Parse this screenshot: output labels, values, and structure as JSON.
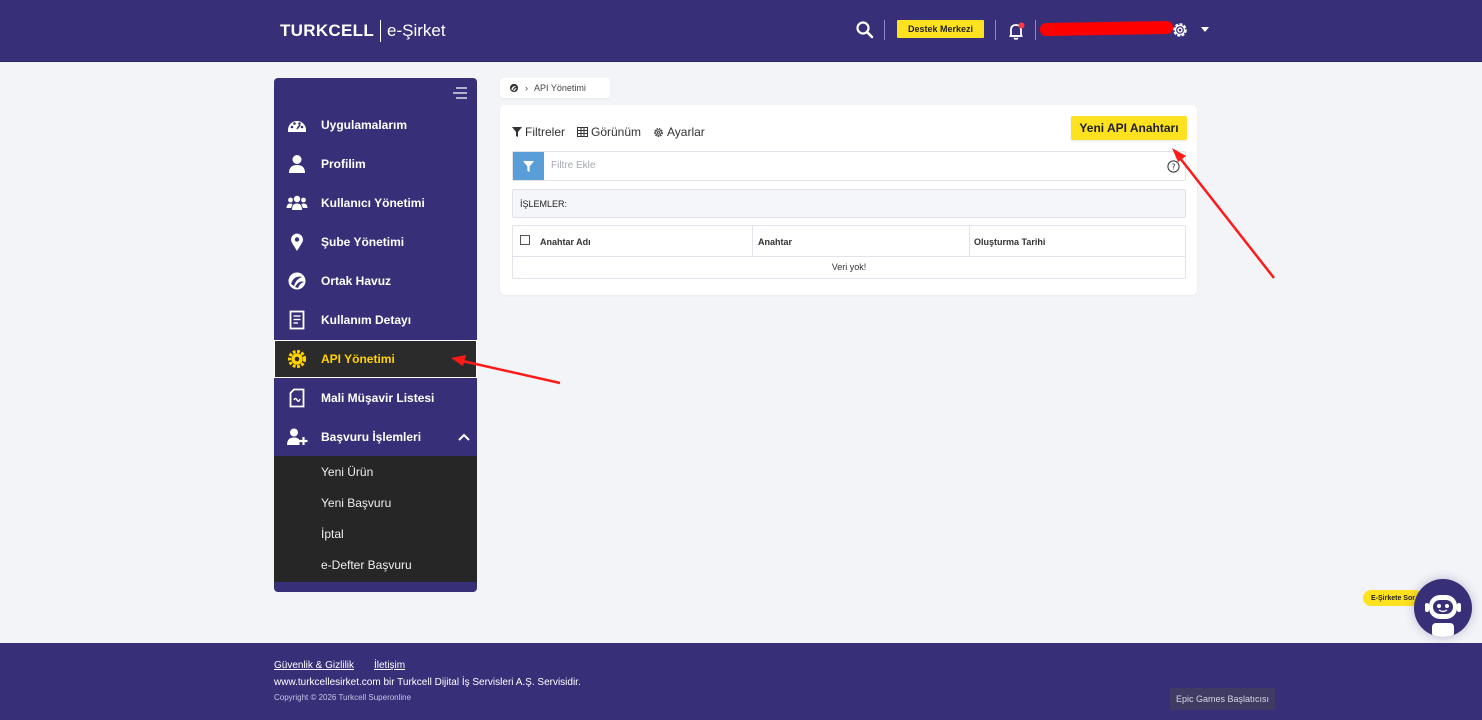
{
  "header": {
    "logo_brand": "TURKCELL",
    "logo_product": "e-Şirket",
    "support_label": "Destek Merkezi",
    "icons": [
      "search-icon",
      "bell-icon",
      "gear-icon",
      "caret-down-icon"
    ],
    "colors": {
      "primary": "#372f78",
      "accent": "#ffe21f"
    }
  },
  "breadcrumb": {
    "items": [
      "API Yönetimi"
    ]
  },
  "sidebar": {
    "items": [
      {
        "label": "Uygulamalarım",
        "icon": "dashboard-icon"
      },
      {
        "label": "Profilim",
        "icon": "user-icon"
      },
      {
        "label": "Kullanıcı Yönetimi",
        "icon": "users-icon"
      },
      {
        "label": "Şube Yönetimi",
        "icon": "location-pin-icon"
      },
      {
        "label": "Ortak Havuz",
        "icon": "turkcell-logo-icon"
      },
      {
        "label": "Kullanım Detayı",
        "icon": "document-icon"
      },
      {
        "label": "API Yönetimi",
        "icon": "gear-icon",
        "active": true
      },
      {
        "label": "Mali Müşavir Listesi",
        "icon": "file-sign-icon"
      },
      {
        "label": "Başvuru İşlemleri",
        "icon": "user-plus-icon",
        "expanded": true
      }
    ],
    "submenu": [
      "Yeni Ürün",
      "Yeni Başvuru",
      "İptal",
      "e-Defter Başvuru"
    ]
  },
  "toolbar": {
    "filters_label": "Filtreler",
    "view_label": "Görünüm",
    "settings_label": "Ayarlar",
    "new_key_label": "Yeni API Anahtarı"
  },
  "filter": {
    "placeholder": "Filtre Ekle"
  },
  "operations": {
    "label": "İŞLEMLER:"
  },
  "table": {
    "columns": [
      "Anahtar Adı",
      "Anahtar",
      "Oluşturma Tarihi"
    ],
    "empty_text": "Veri yok!"
  },
  "footer": {
    "links": [
      "Güvenlik & Gizlilik",
      "İletişim"
    ],
    "text": "www.turkcellesirket.com bir Turkcell Dijital İş Servisleri A.Ş. Servisidir.",
    "copyright": "Copyright © 2026 Turkcell Superonline",
    "taskbar_label": "Epic Games Başlatıcısı"
  },
  "chatbot": {
    "label": "E-Şirkete Sor"
  }
}
